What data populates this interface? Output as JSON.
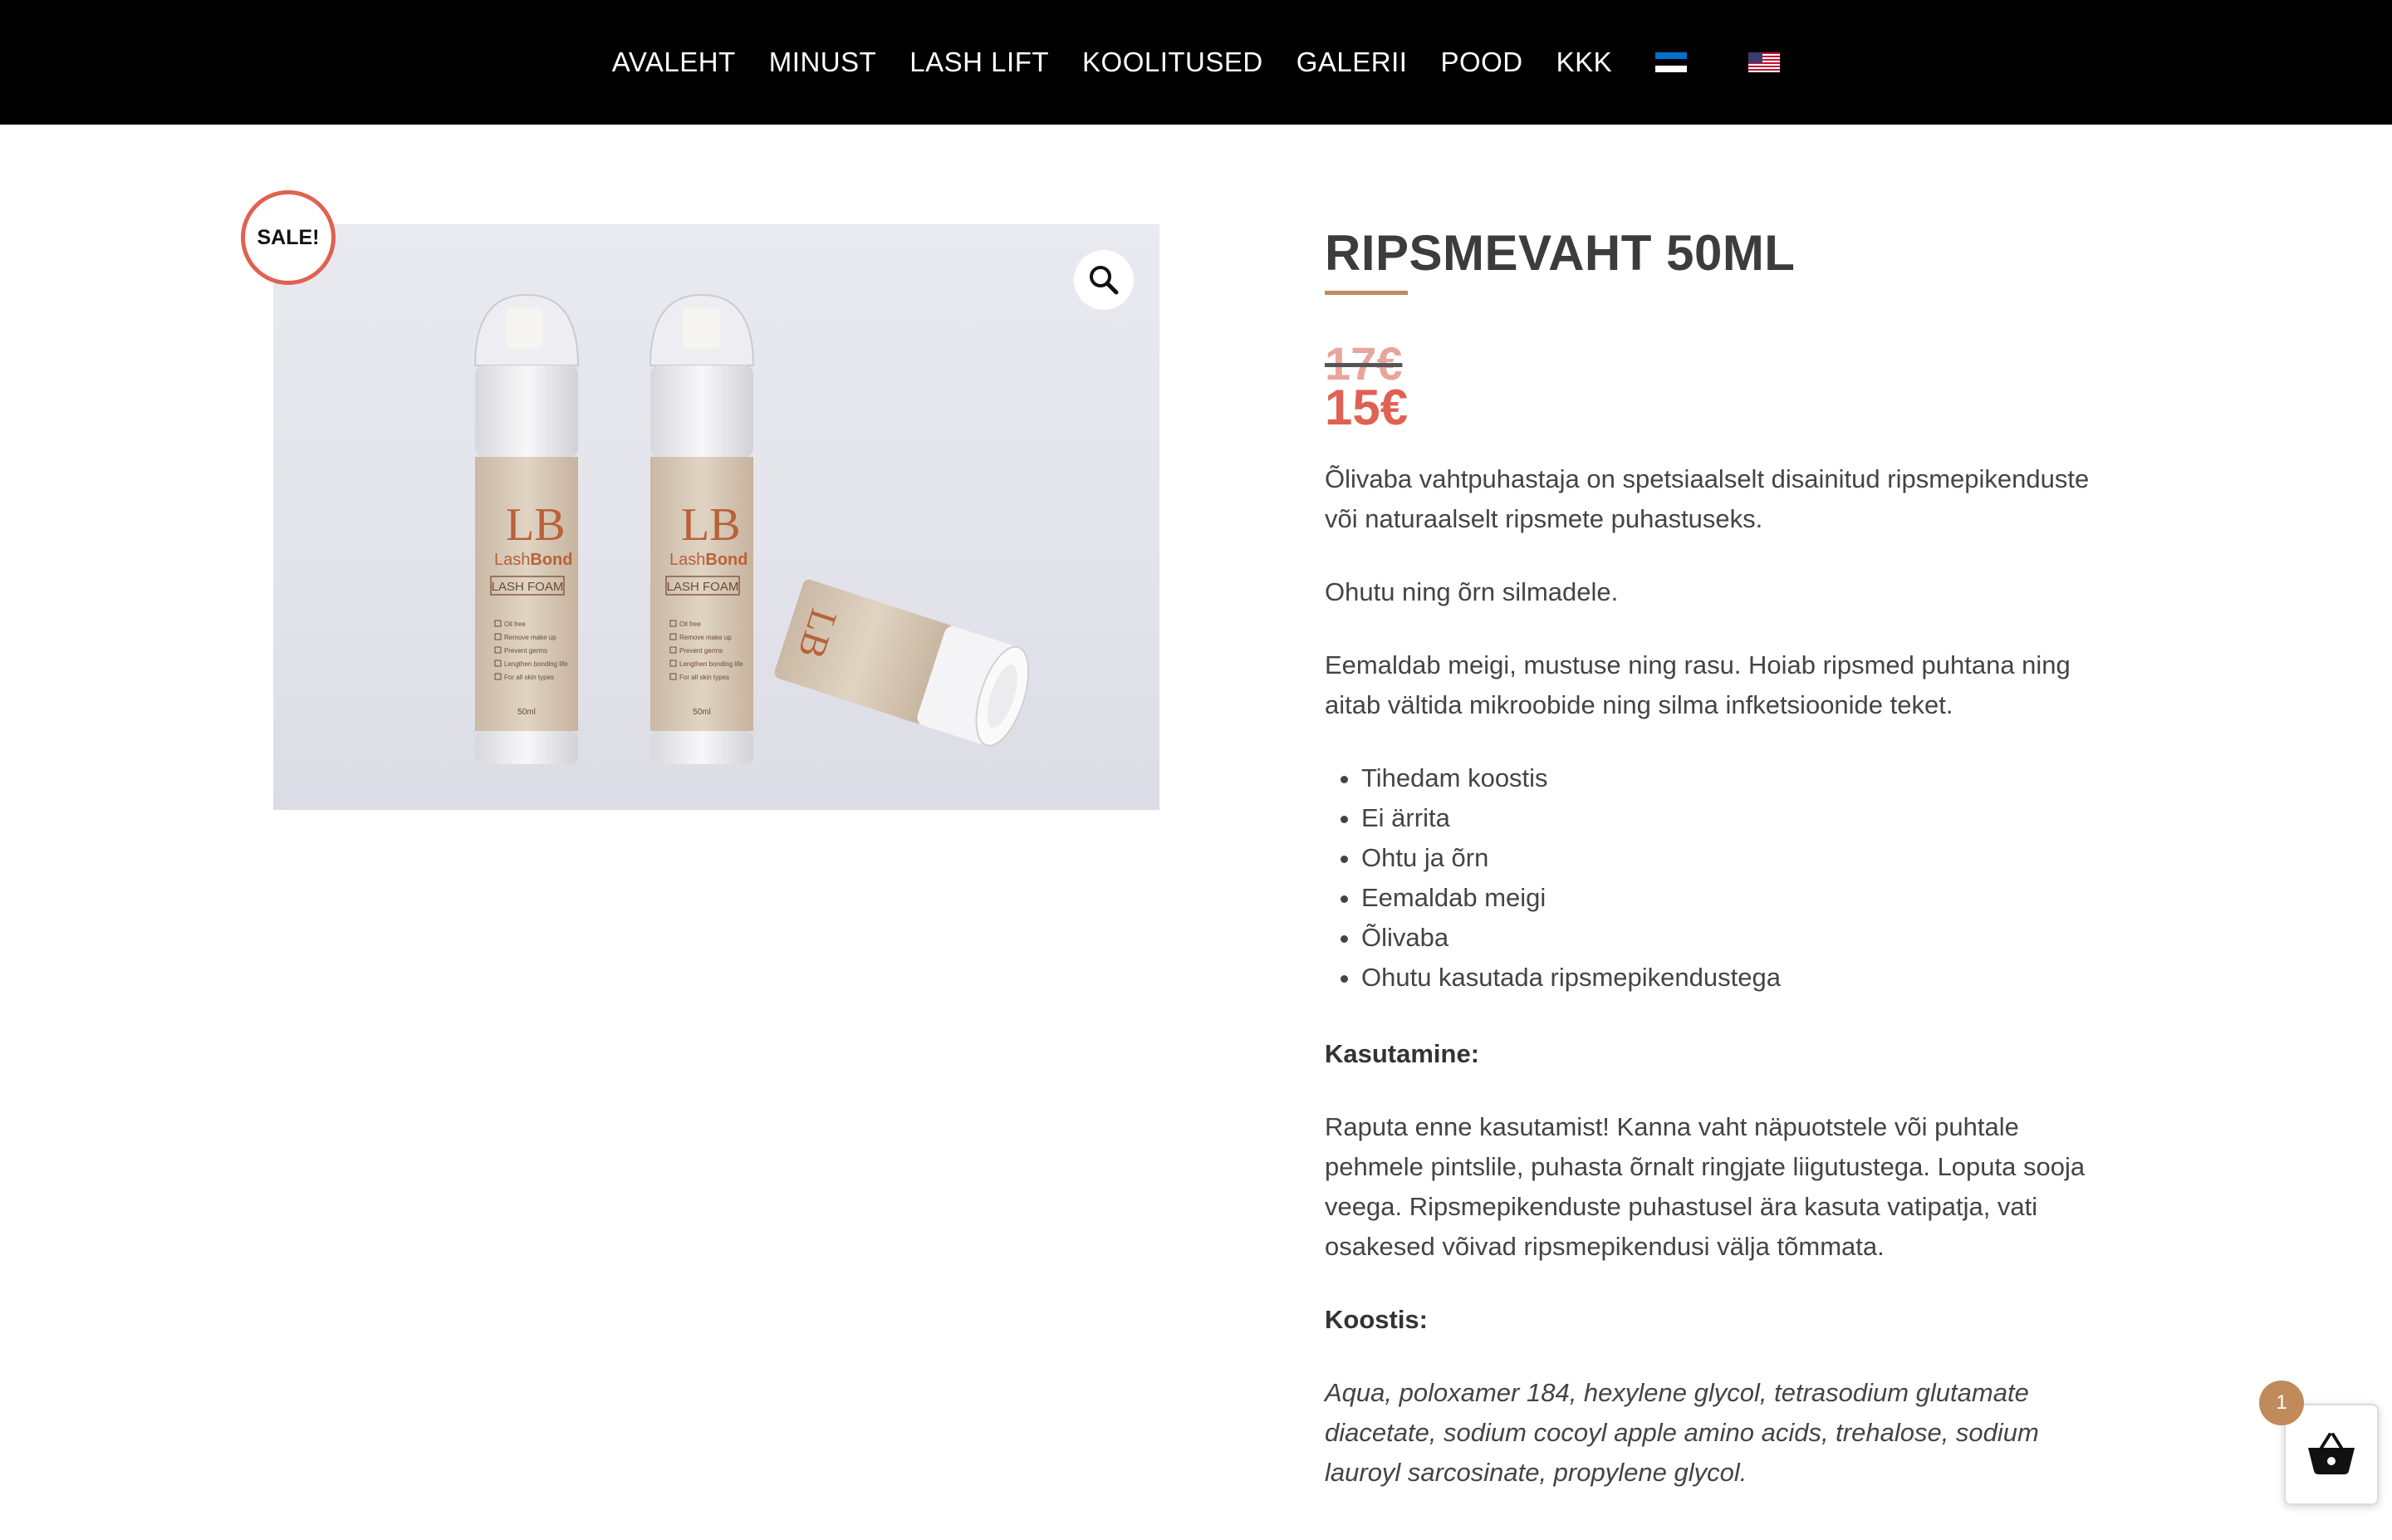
{
  "nav": {
    "items": [
      "AVALEHT",
      "MINUST",
      "LASH LIFT",
      "KOOLITUSED",
      "GALERII",
      "POOD",
      "KKK"
    ],
    "flags": [
      "estonian-flag-icon",
      "us-flag-icon"
    ]
  },
  "product": {
    "sale_badge": "SALE!",
    "title": "RIPSMEVAHT 50ML",
    "price_old": "17€",
    "price_new": "15€",
    "image_icon": "zoom-icon",
    "image_labels": {
      "brand_light": "Lash",
      "brand_bold": "Bond",
      "product": "LASH FOAM",
      "features": [
        "Oil free",
        "Remove make up",
        "Prevent germs",
        "Lengthen bonding life",
        "For all skin types"
      ],
      "volume": "50ml"
    }
  },
  "description": {
    "p1": "Õlivaba vahtpuhastaja on spetsiaalselt disainitud ripsmepikenduste või naturaalselt ripsmete puhastuseks.",
    "p2": "Ohutu ning õrn silmadele.",
    "p3": "Eemaldab meigi, mustuse ning rasu. Hoiab ripsmed puhtana ning aitab vältida mikroobide ning silma infketsioonide teket.",
    "bullets": [
      "Tihedam koostis",
      "Ei ärrita",
      "Ohtu ja õrn",
      "Eemaldab meigi",
      "Õlivaba",
      "Ohutu kasutada ripsmepikendustega"
    ],
    "usage_heading": "Kasutamine:",
    "usage_text": "Raputa enne kasutamist! Kanna vaht näpuotstele või puhtale pehmele pintslile, puhasta õrnalt ringjate liigutustega. Loputa sooja veega. Ripsmepikenduste puhastusel ära kasuta vatipatja, vati osakesed võivad ripsmepikendusi välja tõmmata.",
    "ingredients_heading": "Koostis:",
    "ingredients_text": "Aqua, poloxamer 184, hexylene glycol, tetrasodium glutamate diacetate, sodium cocoyl apple amino acids, trehalose, sodium lauroyl sarcosinate, propylene glycol."
  },
  "cart": {
    "count": "1",
    "icon": "basket-icon"
  },
  "colors": {
    "nav_bg": "#000000",
    "sale": "#e06152",
    "accent": "#c08a5b"
  }
}
